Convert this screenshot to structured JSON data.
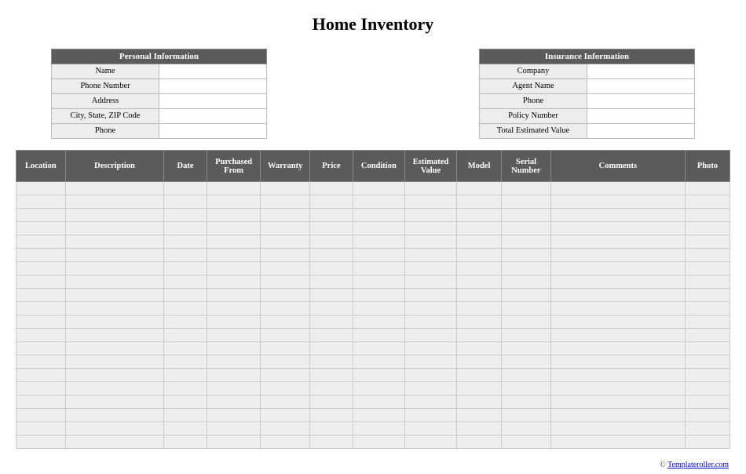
{
  "title": "Home Inventory",
  "personal": {
    "header": "Personal Information",
    "rows": [
      {
        "label": "Name",
        "value": ""
      },
      {
        "label": "Phone Number",
        "value": ""
      },
      {
        "label": "Address",
        "value": ""
      },
      {
        "label": "City, State, ZIP Code",
        "value": ""
      },
      {
        "label": "Phone",
        "value": ""
      }
    ]
  },
  "insurance": {
    "header": "Insurance Information",
    "rows": [
      {
        "label": "Company",
        "value": ""
      },
      {
        "label": "Agent Name",
        "value": ""
      },
      {
        "label": "Phone",
        "value": ""
      },
      {
        "label": "Policy Number",
        "value": ""
      },
      {
        "label": "Total Estimated Value",
        "value": ""
      }
    ]
  },
  "inventory": {
    "columns": [
      "Location",
      "Description",
      "Date",
      "Purchased From",
      "Warranty",
      "Price",
      "Condition",
      "Estimated Value",
      "Model",
      "Serial Number",
      "Comments",
      "Photo"
    ],
    "row_count": 20
  },
  "footer": {
    "copyright": "©",
    "link_text": "Templateroller.com"
  }
}
